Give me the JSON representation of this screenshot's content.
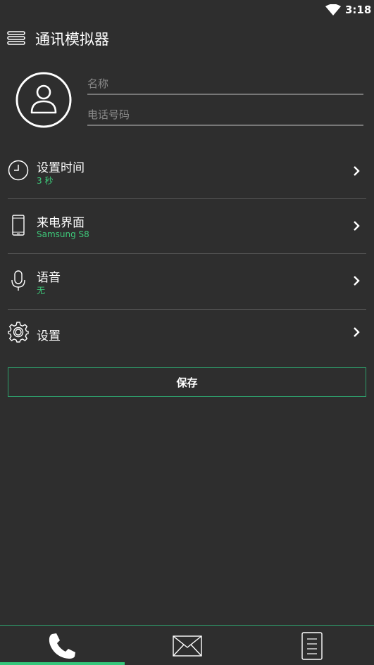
{
  "status_bar": {
    "time": "3:18"
  },
  "header": {
    "title": "通讯模拟器",
    "menu_icon": "hamburger-menu-icon"
  },
  "contact": {
    "avatar_icon": "user-avatar-icon",
    "name_placeholder": "名称",
    "phone_placeholder": "电话号码"
  },
  "settings": {
    "items": [
      {
        "icon": "clock-icon",
        "label": "设置时间",
        "value": "3 秒"
      },
      {
        "icon": "phone-device-icon",
        "label": "来电界面",
        "value": "Samsung S8"
      },
      {
        "icon": "microphone-icon",
        "label": "语音",
        "value": "无"
      },
      {
        "icon": "gear-icon",
        "label": "设置",
        "value": ""
      }
    ]
  },
  "save_button": {
    "label": "保存"
  },
  "bottom_nav": {
    "tabs": [
      {
        "icon": "phone-icon",
        "active": true
      },
      {
        "icon": "mail-icon",
        "active": false
      },
      {
        "icon": "document-icon",
        "active": false
      }
    ]
  },
  "colors": {
    "accent": "#34c77b",
    "background": "#2e2e2e",
    "divider": "#5a5a5a"
  }
}
